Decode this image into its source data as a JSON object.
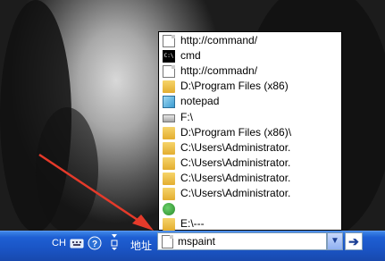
{
  "taskbar": {
    "ime_label": "CH",
    "address_label": "地址",
    "address_value": "mspaint",
    "dropdown_icon": "chevron-down-icon",
    "go_icon": "arrow-right-icon"
  },
  "history": [
    {
      "icon": "document-icon",
      "label": "http://command/"
    },
    {
      "icon": "cmd-icon",
      "label": "cmd"
    },
    {
      "icon": "document-icon",
      "label": "http://commadn/"
    },
    {
      "icon": "folder-icon",
      "label": "D:\\Program Files (x86)"
    },
    {
      "icon": "notepad-icon",
      "label": "notepad"
    },
    {
      "icon": "drive-icon",
      "label": "F:\\"
    },
    {
      "icon": "folder-icon",
      "label": "D:\\Program Files (x86)\\"
    },
    {
      "icon": "folder-icon",
      "label": "C:\\Users\\Administrator."
    },
    {
      "icon": "folder-icon",
      "label": "C:\\Users\\Administrator."
    },
    {
      "icon": "folder-icon",
      "label": "C:\\Users\\Administrator."
    },
    {
      "icon": "folder-icon",
      "label": "C:\\Users\\Administrator."
    },
    {
      "icon": "globe-icon",
      "label": ""
    },
    {
      "icon": "folder-icon",
      "label": "E:\\---"
    }
  ],
  "colors": {
    "taskbar": "#1e5fd3",
    "annotation_arrow": "#e53a2a"
  }
}
